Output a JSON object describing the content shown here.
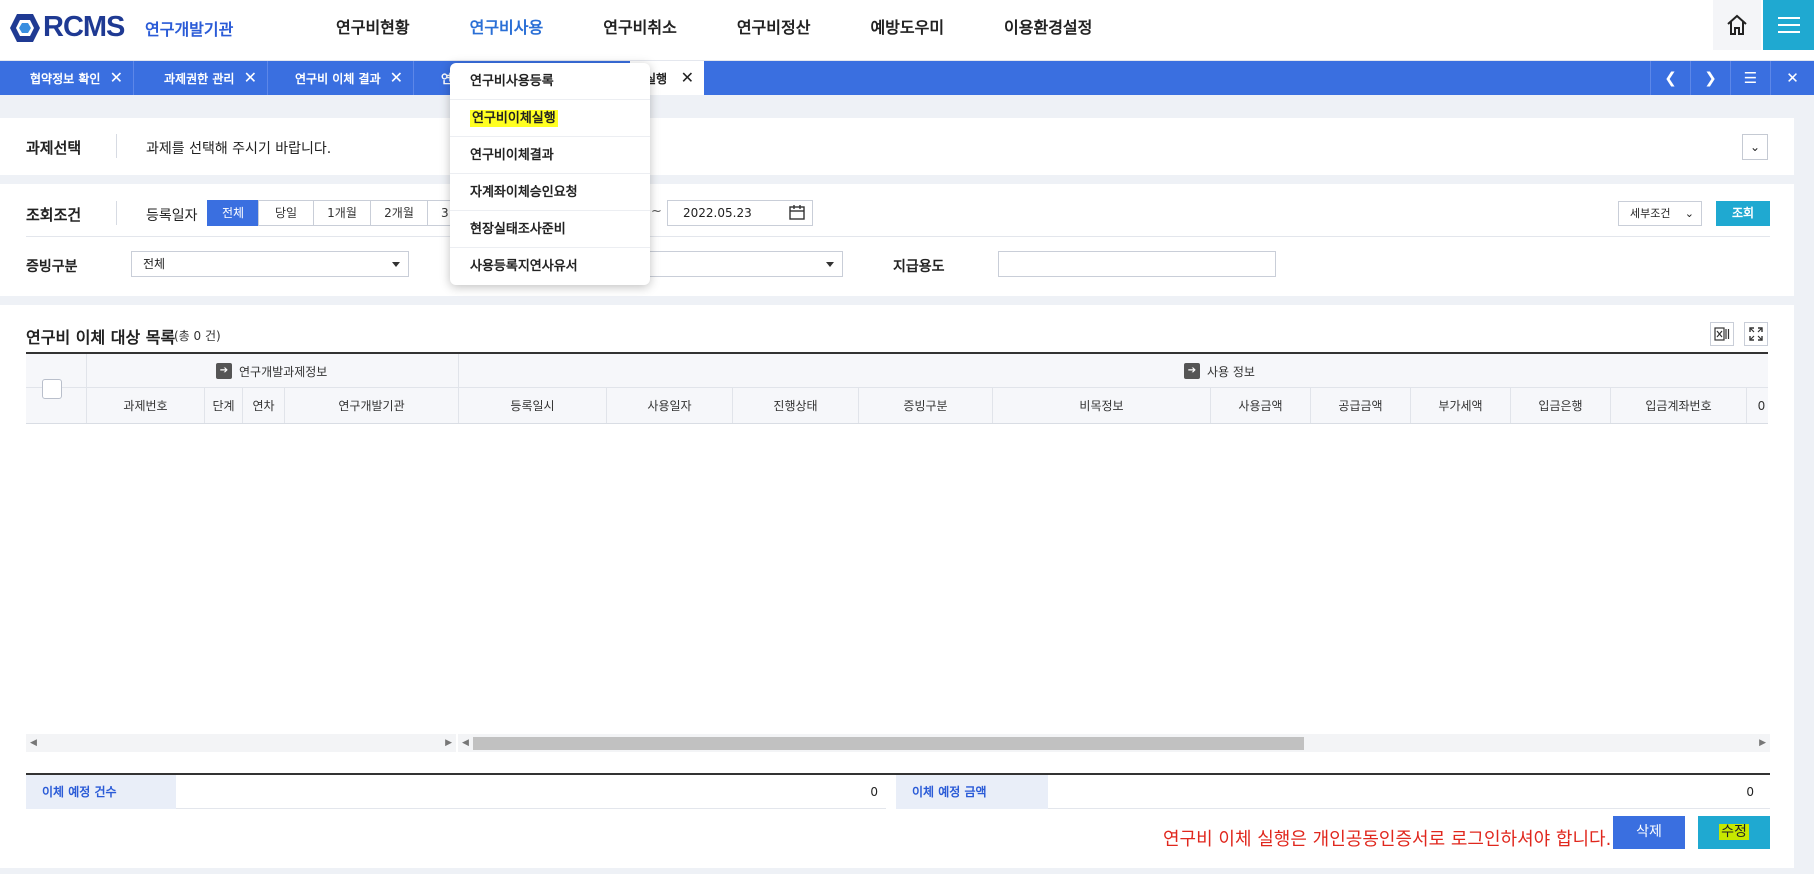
{
  "header": {
    "logo_text": "RCMS",
    "org": "연구개발기관",
    "nav": [
      "연구비현황",
      "연구비사용",
      "연구비취소",
      "연구비정산",
      "예방도우미",
      "이용환경설정"
    ],
    "active_nav": "연구비사용"
  },
  "tabs": [
    {
      "label": "협약정보 확인"
    },
    {
      "label": "과제권한 관리"
    },
    {
      "label": "연구비 이체 결과"
    },
    {
      "label": "연"
    },
    {
      "label": "실행"
    }
  ],
  "dropdown": {
    "items": [
      "연구비사용등록",
      "연구비이체실행",
      "연구비이체결과",
      "자계좌이체승인요청",
      "현장실태조사준비",
      "사용등록지연사유서"
    ],
    "highlighted": "연구비이체실행"
  },
  "project_select": {
    "label": "과제선택",
    "message": "과제를 선택해 주시기 바랍니다."
  },
  "search": {
    "label": "조회조건",
    "reg_date_label": "등록일자",
    "periods": [
      "전체",
      "당일",
      "1개월",
      "2개월",
      "3"
    ],
    "active_period": "전체",
    "tilde": "~",
    "end_date": "2022.05.23",
    "detail_label": "세부조건",
    "search_button": "조회",
    "evidence_label": "증빙구분",
    "evidence_value": "전체",
    "purpose_label": "지급용도",
    "purpose_value": ""
  },
  "list": {
    "title": "연구비 이체 대상 목록",
    "count": "(총 0 건)",
    "group1": "연구개발과제정보",
    "group2": "사용 정보",
    "columns": [
      "과제번호",
      "단계",
      "연차",
      "연구개발기관",
      "등록일시",
      "사용일자",
      "진행상태",
      "증빙구분",
      "비목정보",
      "사용금액",
      "공급금액",
      "부가세액",
      "입금은행",
      "입금계좌번호",
      "0"
    ]
  },
  "summary": {
    "count_label": "이체 예정 건수",
    "count_value": "0",
    "amount_label": "이체 예정 금액",
    "amount_value": "0"
  },
  "footer": {
    "notice": "연구비 이체 실행은 개인공동인증서로 로그인하셔야 합니다.",
    "delete_button": "삭제",
    "edit_button": "수정"
  },
  "colors": {
    "primary_blue": "#3a6fe0",
    "teal": "#1fa9d1",
    "notice_red": "#e0271d",
    "highlight_yellow": "#ffff22"
  }
}
